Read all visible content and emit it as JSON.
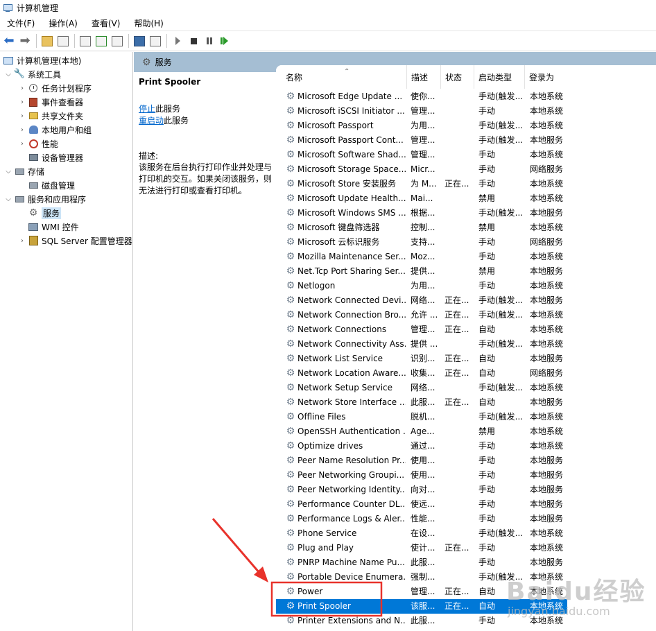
{
  "window": {
    "title": "计算机管理"
  },
  "menu": [
    "文件(F)",
    "操作(A)",
    "查看(V)",
    "帮助(H)"
  ],
  "tree": [
    {
      "label": "计算机管理(本地)",
      "icon": "computer-icon"
    },
    {
      "label": "系统工具",
      "icon": "tools-icon"
    },
    {
      "label": "任务计划程序",
      "icon": "clock-icon"
    },
    {
      "label": "事件查看器",
      "icon": "event-viewer-icon"
    },
    {
      "label": "共享文件夹",
      "icon": "shared-folder-icon"
    },
    {
      "label": "本地用户和组",
      "icon": "users-icon"
    },
    {
      "label": "性能",
      "icon": "performance-icon"
    },
    {
      "label": "设备管理器",
      "icon": "device-manager-icon"
    },
    {
      "label": "存储",
      "icon": "storage-icon"
    },
    {
      "label": "磁盘管理",
      "icon": "disk-icon"
    },
    {
      "label": "服务和应用程序",
      "icon": "apps-icon"
    },
    {
      "label": "服务",
      "icon": "gear-icon"
    },
    {
      "label": "WMI 控件",
      "icon": "wmi-icon"
    },
    {
      "label": "SQL Server 配置管理器",
      "icon": "sql-icon"
    }
  ],
  "pane": {
    "title": "服务"
  },
  "detail": {
    "service_name": "Print Spooler",
    "stop_link": "停止",
    "stop_suffix": "此服务",
    "restart_link": "重启动",
    "restart_suffix": "此服务",
    "desc_label": "描述:",
    "desc_text": "该服务在后台执行打印作业并处理与打印机的交互。如果关闭该服务，则无法进行打印或查看打印机。"
  },
  "columns": {
    "name": "名称",
    "desc": "描述",
    "status": "状态",
    "start": "启动类型",
    "logon": "登录为"
  },
  "rows": [
    {
      "name": "Microsoft Edge Update ...",
      "desc": "使你...",
      "status": "",
      "start": "手动(触发...",
      "logon": "本地系统"
    },
    {
      "name": "Microsoft iSCSI Initiator ...",
      "desc": "管理...",
      "status": "",
      "start": "手动",
      "logon": "本地系统"
    },
    {
      "name": "Microsoft Passport",
      "desc": "为用...",
      "status": "",
      "start": "手动(触发...",
      "logon": "本地系统"
    },
    {
      "name": "Microsoft Passport Cont...",
      "desc": "管理...",
      "status": "",
      "start": "手动(触发...",
      "logon": "本地服务"
    },
    {
      "name": "Microsoft Software Shad...",
      "desc": "管理...",
      "status": "",
      "start": "手动",
      "logon": "本地系统"
    },
    {
      "name": "Microsoft Storage Space...",
      "desc": "Micr...",
      "status": "",
      "start": "手动",
      "logon": "网络服务"
    },
    {
      "name": "Microsoft Store 安装服务",
      "desc": "为 M...",
      "status": "正在...",
      "start": "手动",
      "logon": "本地系统"
    },
    {
      "name": "Microsoft Update Health...",
      "desc": "Mai...",
      "status": "",
      "start": "禁用",
      "logon": "本地系统"
    },
    {
      "name": "Microsoft Windows SMS ...",
      "desc": "根据...",
      "status": "",
      "start": "手动(触发...",
      "logon": "本地服务"
    },
    {
      "name": "Microsoft 键盘筛选器",
      "desc": "控制...",
      "status": "",
      "start": "禁用",
      "logon": "本地系统"
    },
    {
      "name": "Microsoft 云标识服务",
      "desc": "支持...",
      "status": "",
      "start": "手动",
      "logon": "网络服务"
    },
    {
      "name": "Mozilla Maintenance Ser...",
      "desc": "Moz...",
      "status": "",
      "start": "手动",
      "logon": "本地系统"
    },
    {
      "name": "Net.Tcp Port Sharing Ser...",
      "desc": "提供...",
      "status": "",
      "start": "禁用",
      "logon": "本地服务"
    },
    {
      "name": "Netlogon",
      "desc": "为用...",
      "status": "",
      "start": "手动",
      "logon": "本地系统"
    },
    {
      "name": "Network Connected Devi...",
      "desc": "网络...",
      "status": "正在...",
      "start": "手动(触发...",
      "logon": "本地服务"
    },
    {
      "name": "Network Connection Bro...",
      "desc": "允许 ...",
      "status": "正在...",
      "start": "手动(触发...",
      "logon": "本地系统"
    },
    {
      "name": "Network Connections",
      "desc": "管理...",
      "status": "正在...",
      "start": "自动",
      "logon": "本地系统"
    },
    {
      "name": "Network Connectivity Ass...",
      "desc": "提供 ...",
      "status": "",
      "start": "手动(触发...",
      "logon": "本地系统"
    },
    {
      "name": "Network List Service",
      "desc": "识别...",
      "status": "正在...",
      "start": "自动",
      "logon": "本地服务"
    },
    {
      "name": "Network Location Aware...",
      "desc": "收集...",
      "status": "正在...",
      "start": "自动",
      "logon": "网络服务"
    },
    {
      "name": "Network Setup Service",
      "desc": "网络...",
      "status": "",
      "start": "手动(触发...",
      "logon": "本地系统"
    },
    {
      "name": "Network Store Interface ...",
      "desc": "此服...",
      "status": "正在...",
      "start": "自动",
      "logon": "本地服务"
    },
    {
      "name": "Offline Files",
      "desc": "脱机...",
      "status": "",
      "start": "手动(触发...",
      "logon": "本地系统"
    },
    {
      "name": "OpenSSH Authentication ...",
      "desc": "Age...",
      "status": "",
      "start": "禁用",
      "logon": "本地系统"
    },
    {
      "name": "Optimize drives",
      "desc": "通过...",
      "status": "",
      "start": "手动",
      "logon": "本地系统"
    },
    {
      "name": "Peer Name Resolution Pr...",
      "desc": "使用...",
      "status": "",
      "start": "手动",
      "logon": "本地服务"
    },
    {
      "name": "Peer Networking Groupi...",
      "desc": "使用...",
      "status": "",
      "start": "手动",
      "logon": "本地服务"
    },
    {
      "name": "Peer Networking Identity...",
      "desc": "向对...",
      "status": "",
      "start": "手动",
      "logon": "本地服务"
    },
    {
      "name": "Performance Counter DL...",
      "desc": "使远...",
      "status": "",
      "start": "手动",
      "logon": "本地服务"
    },
    {
      "name": "Performance Logs & Aler...",
      "desc": "性能...",
      "status": "",
      "start": "手动",
      "logon": "本地服务"
    },
    {
      "name": "Phone Service",
      "desc": "在设...",
      "status": "",
      "start": "手动(触发...",
      "logon": "本地系统"
    },
    {
      "name": "Plug and Play",
      "desc": "使计...",
      "status": "正在...",
      "start": "手动",
      "logon": "本地系统"
    },
    {
      "name": "PNRP Machine Name Pu...",
      "desc": "此服...",
      "status": "",
      "start": "手动",
      "logon": "本地服务"
    },
    {
      "name": "Portable Device Enumera...",
      "desc": "强制...",
      "status": "",
      "start": "手动(触发...",
      "logon": "本地系统"
    },
    {
      "name": "Power",
      "desc": "管理...",
      "status": "正在...",
      "start": "自动",
      "logon": "本地系统"
    },
    {
      "name": "Print Spooler",
      "desc": "该服...",
      "status": "正在...",
      "start": "自动",
      "logon": "本地系统"
    },
    {
      "name": "Printer Extensions and N...",
      "desc": "此服...",
      "status": "",
      "start": "手动",
      "logon": "本地系统"
    }
  ],
  "watermark": {
    "brand": "Baidu经验",
    "url": "jingyan.baidu.com"
  },
  "colors": {
    "selected_row": "#0078d7",
    "pane_header": "#a5bed3",
    "annotation": "#e8322b",
    "link": "#0066cc"
  }
}
